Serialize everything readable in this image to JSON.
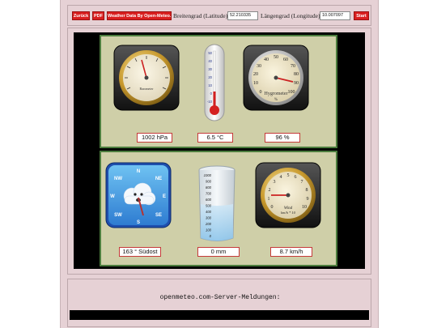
{
  "toolbar": {
    "back_label": "Zurück",
    "pdf_label": "PDF",
    "source_label": "Weather Data By Open-Meteo.com",
    "lat_label": "Breitengrad (Latitude):",
    "lat_value": "52.210335",
    "lon_label": "Längengrad (Longitude):",
    "lon_value": "10.007097",
    "start_label": "Start"
  },
  "barometer": {
    "face_label": "Barometer",
    "readout": "1002 hPa"
  },
  "thermometer": {
    "scale": [
      "50",
      "40",
      "30",
      "20",
      "10",
      "0",
      "-10"
    ],
    "readout": "6.5 °C"
  },
  "hygrometer": {
    "ticks": [
      "0",
      "10",
      "20",
      "30",
      "40",
      "50",
      "60",
      "70",
      "80",
      "90",
      "100"
    ],
    "face_label": "Hygrometer",
    "unit": "%",
    "readout": "96 %"
  },
  "compass": {
    "directions": [
      "N",
      "NE",
      "E",
      "SE",
      "S",
      "SW",
      "W",
      "NW"
    ],
    "readout": "163 ° Südost"
  },
  "rain": {
    "scale": [
      "1000",
      "900",
      "800",
      "700",
      "600",
      "500",
      "400",
      "300",
      "200",
      "100",
      "0"
    ],
    "readout": "0 mm"
  },
  "wind": {
    "ticks": [
      "0",
      "1",
      "2",
      "3",
      "4",
      "5",
      "6",
      "7",
      "8",
      "9",
      "10"
    ],
    "face_label": "Wind",
    "unit": "km/h * 10",
    "readout": "8.7 km/h"
  },
  "messages": {
    "title": "openmeteo.com-Server-Meldungen:"
  }
}
